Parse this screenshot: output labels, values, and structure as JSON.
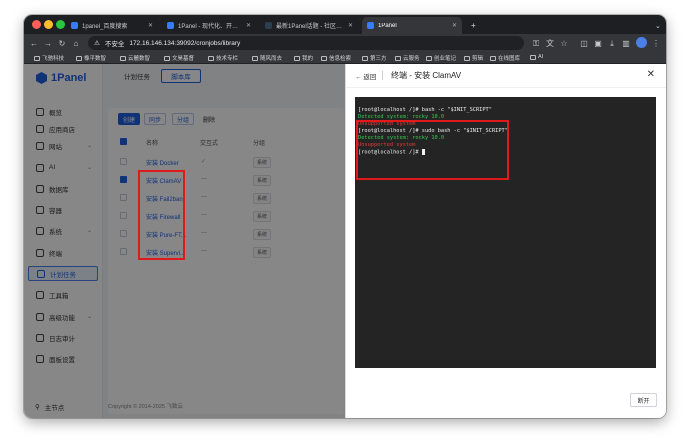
{
  "browser": {
    "tabs": [
      {
        "title": "1panel_百度搜索",
        "icon": "baidu-icon"
      },
      {
        "title": "1Panel - 现代化、开源的 Linux",
        "icon": "1panel-icon"
      },
      {
        "title": "最新1Panel话题 - 社区论坛 - F",
        "icon": "forum-icon"
      },
      {
        "title": "1Panel",
        "icon": "1panel-icon"
      }
    ],
    "new_tab": "+",
    "insecure_label": "不安全",
    "url": "172.16.146.134:39092/cronjobs/library",
    "bookmarks": [
      "飞驰科技",
      "橡平数智",
      "云麓数智",
      "文昊基督",
      "技术专栏",
      "随风而去",
      "我的",
      "信息检索",
      "第三方",
      "云服务",
      "创业笔记",
      "剪辑",
      "在线图库",
      "AI"
    ]
  },
  "sidebar": {
    "logo": "1Panel",
    "items": [
      {
        "label": "概览",
        "icon": "home-icon",
        "arrow": ""
      },
      {
        "label": "应用商店",
        "icon": "store-icon",
        "arrow": ""
      },
      {
        "label": "网站",
        "icon": "globe-icon",
        "arrow": "⌄"
      },
      {
        "label": "AI",
        "icon": "ai-icon",
        "arrow": "⌄"
      },
      {
        "label": "数据库",
        "icon": "database-icon",
        "arrow": ""
      },
      {
        "label": "容器",
        "icon": "container-icon",
        "arrow": ""
      },
      {
        "label": "系统",
        "icon": "system-icon",
        "arrow": "⌄"
      },
      {
        "label": "终端",
        "icon": "terminal-icon",
        "arrow": ""
      },
      {
        "label": "计划任务",
        "icon": "cron-icon",
        "arrow": ""
      },
      {
        "label": "工具箱",
        "icon": "toolbox-icon",
        "arrow": ""
      },
      {
        "label": "高级功能",
        "icon": "advanced-icon",
        "arrow": "⌄"
      },
      {
        "label": "日志审计",
        "icon": "log-icon",
        "arrow": ""
      },
      {
        "label": "面板设置",
        "icon": "settings-icon",
        "arrow": ""
      }
    ],
    "node": "主节点"
  },
  "main": {
    "tabs": [
      "计划任务",
      "脚本库"
    ],
    "actions": {
      "create": "创建",
      "sync": "同步",
      "group": "分组",
      "delete": "删除"
    },
    "columns": {
      "name": "名称",
      "interactive": "交互式",
      "group": "分组"
    },
    "rows": [
      {
        "name": "安装 Docker",
        "interactive": "✓",
        "group": "系统",
        "checked": false
      },
      {
        "name": "安装 ClamAV",
        "interactive": "—",
        "group": "系统",
        "checked": true
      },
      {
        "name": "安装 Fail2ban",
        "interactive": "—",
        "group": "系统",
        "checked": false
      },
      {
        "name": "安装 Firewall",
        "interactive": "—",
        "group": "系统",
        "checked": false
      },
      {
        "name": "安装 Pure-FT...",
        "interactive": "—",
        "group": "系统",
        "checked": false
      },
      {
        "name": "安装 Supervi...",
        "interactive": "—",
        "group": "系统",
        "checked": false
      }
    ],
    "copyright": "Copyright © 2014-2025 飞致云"
  },
  "drawer": {
    "back": "返回",
    "title": "终端 - 安装 ClamAV",
    "close": "✕",
    "cancel": "断开",
    "terminal": {
      "cmd1": "[root@localhost /]# bash -c \"$INIT_SCRIPT\"",
      "out1": "Detected system: rocky 10.0",
      "err1": "Unsupported system",
      "cmd2": "[root@localhost /]# sudo bash -c \"$INIT_SCRIPT\"",
      "out2": "Detected system: rocky 10.0",
      "err2": "Unsupported system",
      "prompt": "[root@localhost /]# "
    }
  },
  "colors": {
    "accent": "#1f5fe0",
    "highlight": "#e0191b",
    "success": "#3cc84f"
  }
}
